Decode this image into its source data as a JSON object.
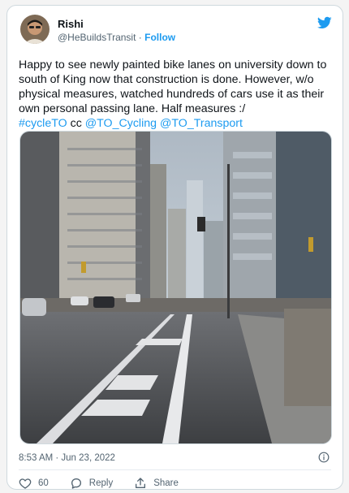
{
  "tweet": {
    "author_name": "Rishi",
    "handle": "@HeBuildsTransit",
    "separator": " · ",
    "follow_label": "Follow",
    "text_part1": "Happy to see newly painted bike lanes on university down to south of King now that construction is done. However, w/o physical measures, watched hundreds of cars use it as their own personal passing lane. Half measures :/",
    "hashtag": "#cycleTO",
    "text_cc": " cc ",
    "mention1": "@TO_Cycling",
    "mention2": "@TO_Transport",
    "timestamp": "8:53 AM · Jun 23, 2022"
  },
  "actions": {
    "like_count": "60",
    "reply_label": "Reply",
    "share_label": "Share"
  },
  "icons": {
    "brand": "twitter-bird-icon",
    "info": "info-icon",
    "like": "heart-icon",
    "reply": "reply-icon",
    "share": "share-icon"
  },
  "colors": {
    "accent": "#1d9bf0",
    "text": "#0f1419",
    "muted": "#536471",
    "border": "#cfd9de"
  }
}
